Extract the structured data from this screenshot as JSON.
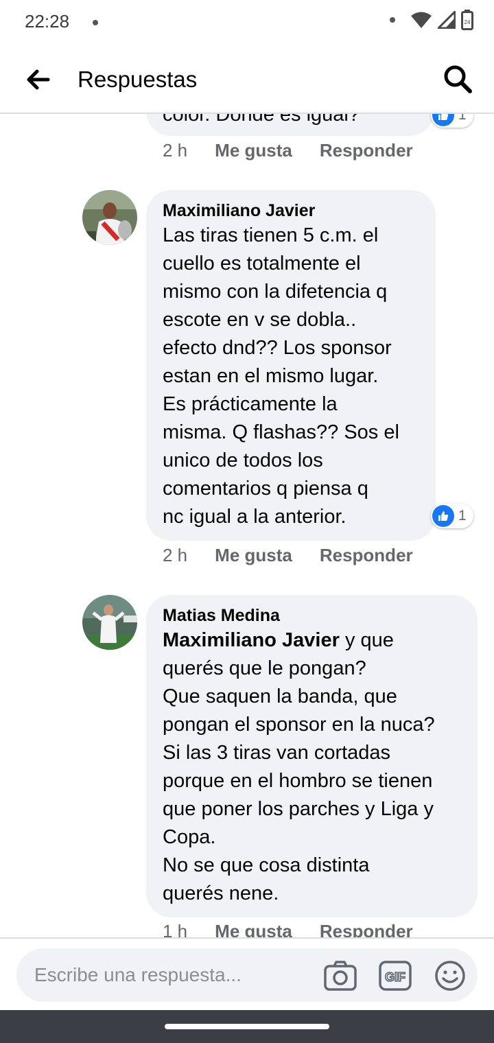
{
  "status_bar": {
    "time": "22:28"
  },
  "header": {
    "title": "Respuestas"
  },
  "comments": [
    {
      "text_fragment": "color. Donde es igual?",
      "time": "2 h",
      "like_label": "Me gusta",
      "reply_label": "Responder",
      "reactions": "1"
    },
    {
      "author": "Maximiliano Javier",
      "text": "Las tiras tienen 5 c.m. el\ncuello es totalmente el\nmismo con la difetencia q\nescote en v se dobla..\nefecto dnd?? Los sponsor\nestan en el mismo lugar.\nEs prácticamente la\nmisma. Q flashas?? Sos el\nunico de todos los\ncomentarios q piensa q\nnc igual a la anterior.",
      "time": "2 h",
      "like_label": "Me gusta",
      "reply_label": "Responder",
      "reactions": "1"
    },
    {
      "author": "Matias Medina",
      "mention": "Maximiliano Javier",
      "text_after_mention": " y que\nquerés que le pongan?\nQue saquen la banda, que\npongan el sponsor en la nuca?\nSi las 3 tiras van cortadas\nporque en el hombro se tienen\nque poner los parches y Liga y\nCopa.\nNo se que cosa distinta\nquerés nene.",
      "time": "1 h",
      "like_label": "Me gusta",
      "reply_label": "Responder"
    }
  ],
  "composer": {
    "placeholder": "Escribe una respuesta..."
  },
  "colors": {
    "accent": "#1877f2",
    "bubble": "#f0f2f5",
    "meta": "#65676b"
  },
  "icons": [
    "back-arrow-icon",
    "search-icon",
    "wifi-icon",
    "signal-icon",
    "battery-icon",
    "like-icon",
    "camera-icon",
    "gif-icon",
    "emoji-icon"
  ]
}
